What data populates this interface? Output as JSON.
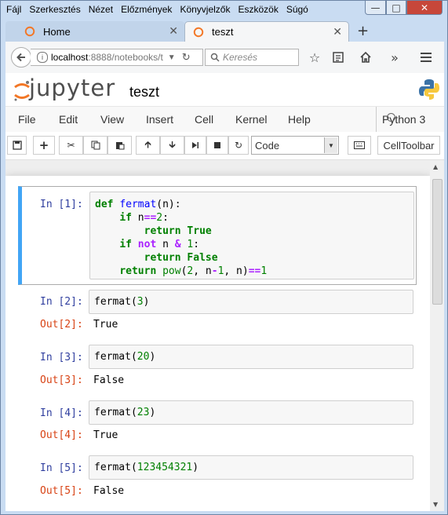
{
  "window": {
    "menu": [
      "Fájl",
      "Szerkesztés",
      "Nézet",
      "Előzmények",
      "Könyvjelzők",
      "Eszközök",
      "Súgó"
    ]
  },
  "tabs": [
    {
      "label": "Home"
    },
    {
      "label": "teszt"
    }
  ],
  "navbar": {
    "url_host": "localhost",
    "url_path": ":8888/notebooks/t",
    "search_placeholder": "Keresés"
  },
  "jupyter": {
    "logo": "jupyter",
    "notebook_title": "teszt",
    "menu": [
      "File",
      "Edit",
      "View",
      "Insert",
      "Cell",
      "Kernel",
      "Help"
    ],
    "kernel_name": "Python 3",
    "cell_type": "Code",
    "celltoolbar_label": "CellToolbar"
  },
  "cells": [
    {
      "in": "In [1]:"
    },
    {
      "in": "In [2]:",
      "code": "fermat(3)",
      "out": "Out[2]:",
      "result": "True"
    },
    {
      "in": "In [3]:",
      "code": "fermat(20)",
      "out": "Out[3]:",
      "result": "False"
    },
    {
      "in": "In [4]:",
      "code": "fermat(23)",
      "out": "Out[4]:",
      "result": "True"
    },
    {
      "in": "In [5]:",
      "code": "fermat(123454321)",
      "out": "Out[5]:",
      "result": "False"
    }
  ],
  "cell1_code": {
    "l1_def": "def",
    "l1_name": "fermat",
    "l1_rest": "(n):",
    "l2_if": "if",
    "l2_n": "n",
    "l2_op": "==",
    "l2_num": "2",
    "l2_colon": ":",
    "l3_return": "return",
    "l3_val": "True",
    "l4_if": "if",
    "l4_not": "not",
    "l4_n": "n",
    "l4_amp": "&",
    "l4_num": "1",
    "l4_colon": ":",
    "l5_return": "return",
    "l5_val": "False",
    "l6_return": "return",
    "l6_pow": "pow",
    "l6_a": "(",
    "l6_2": "2",
    "l6_b": ", n",
    "l6_minus": "-",
    "l6_1": "1",
    "l6_c": ", n)",
    "l6_eq": "==",
    "l6_end": "1"
  }
}
